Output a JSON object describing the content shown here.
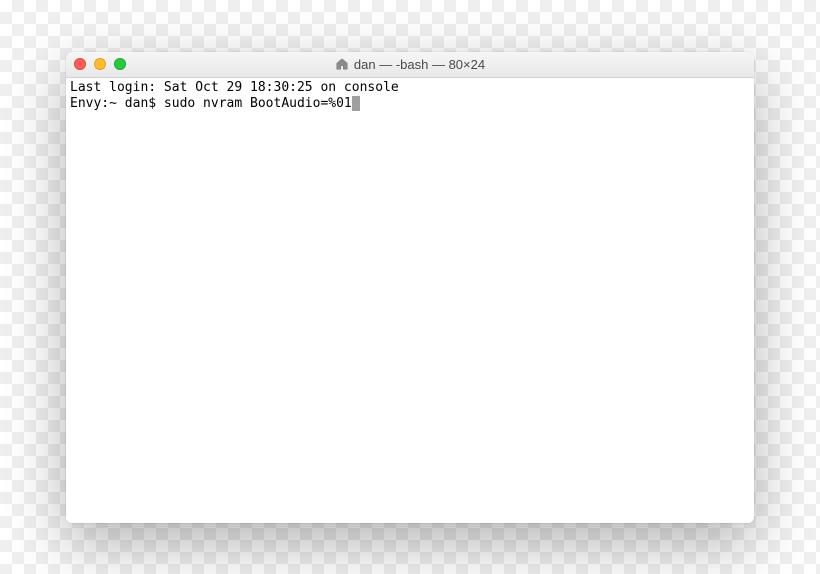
{
  "window": {
    "title": "dan — -bash — 80×24",
    "icon": "home-icon"
  },
  "terminal": {
    "line1": "Last login: Sat Oct 29 18:30:25 on console",
    "prompt": "Envy:~ dan$ ",
    "command": "sudo nvram BootAudio=%01"
  }
}
